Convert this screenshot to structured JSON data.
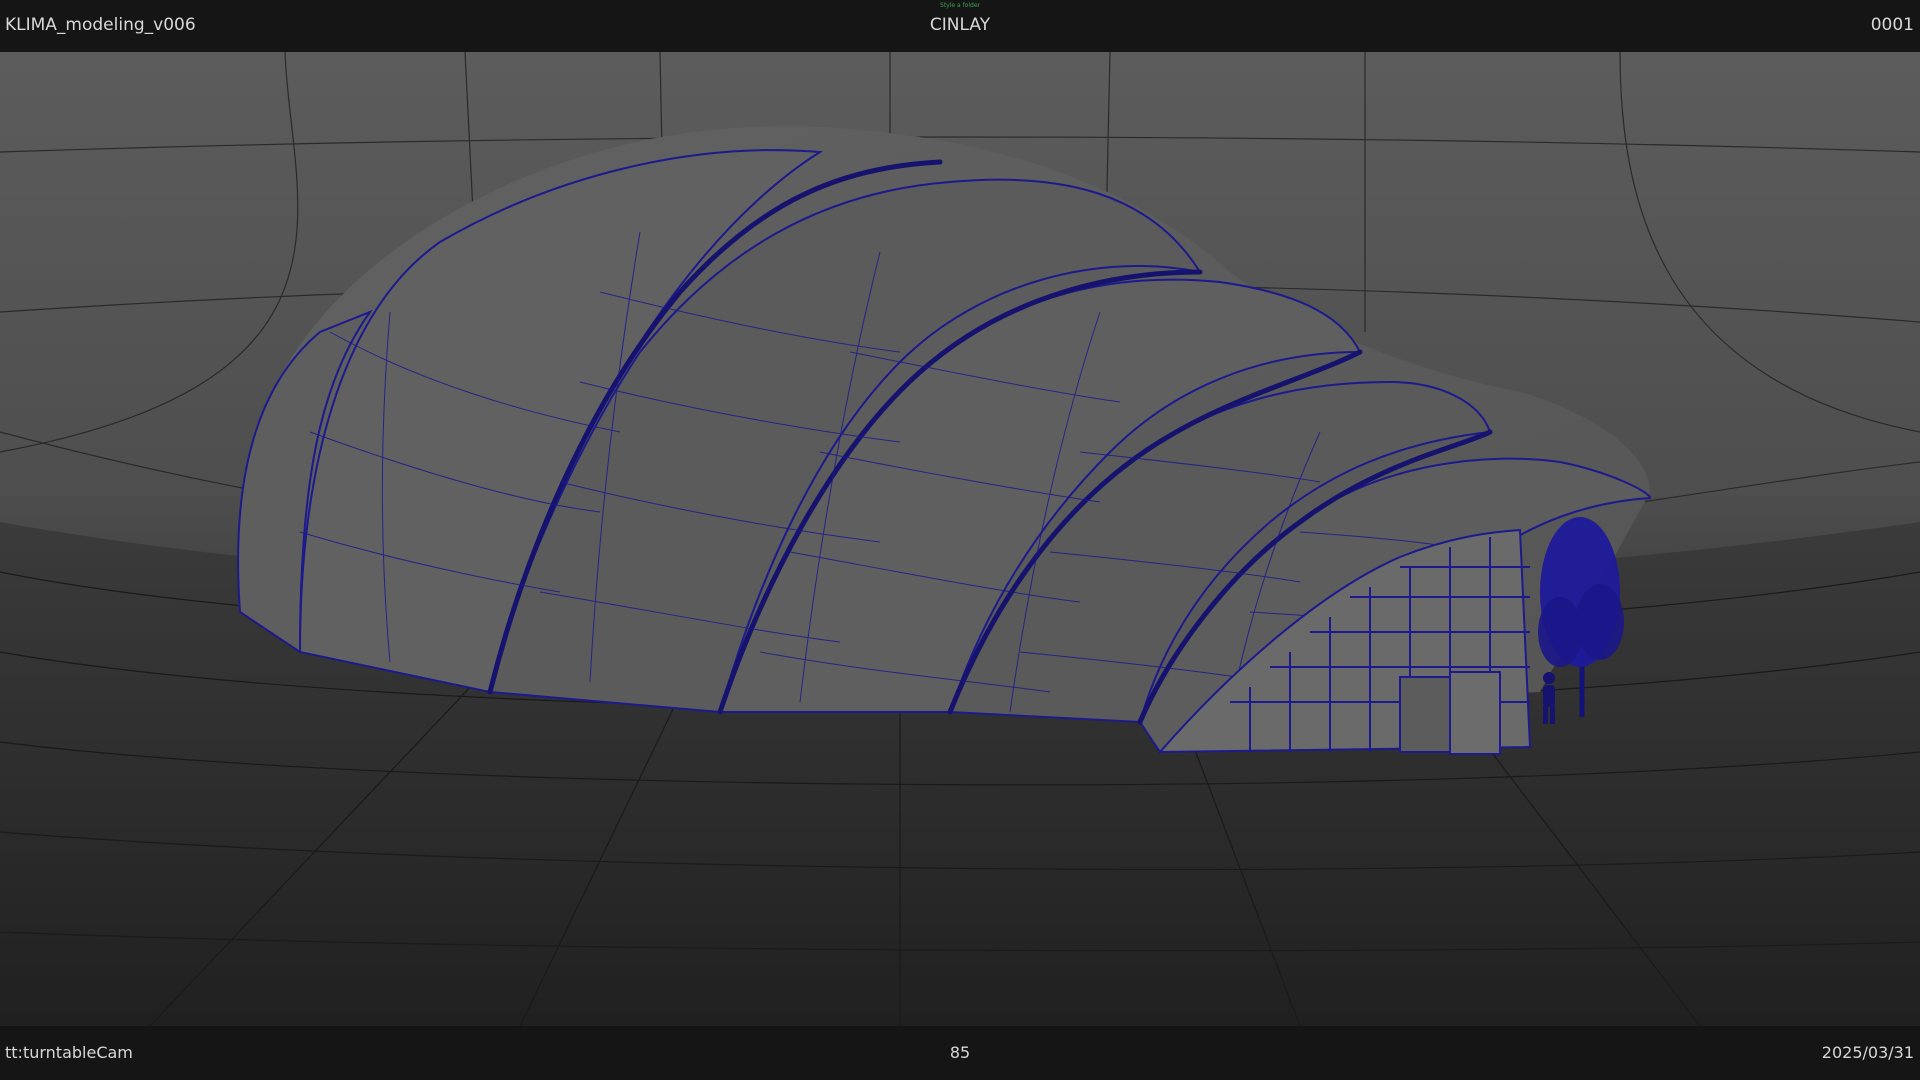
{
  "hud": {
    "scene_name": "KLIMA_modeling_v006",
    "studio": "CINLAY",
    "frame_number": "0001",
    "small_note": "Style a folder",
    "camera": "tt:turntableCam",
    "focal_length": "85",
    "date": "2025/03/31"
  },
  "colors": {
    "wireframe": "#1c1a8c",
    "surface": "#5a5a5a",
    "backdrop": "#4c4c4c",
    "floor": "#262626",
    "hud_background": "#151515",
    "hud_text": "#d8d8d8",
    "note_text": "#3fa34d"
  },
  "icons": {
    "tree": "tree-icon",
    "person": "person-icon"
  }
}
